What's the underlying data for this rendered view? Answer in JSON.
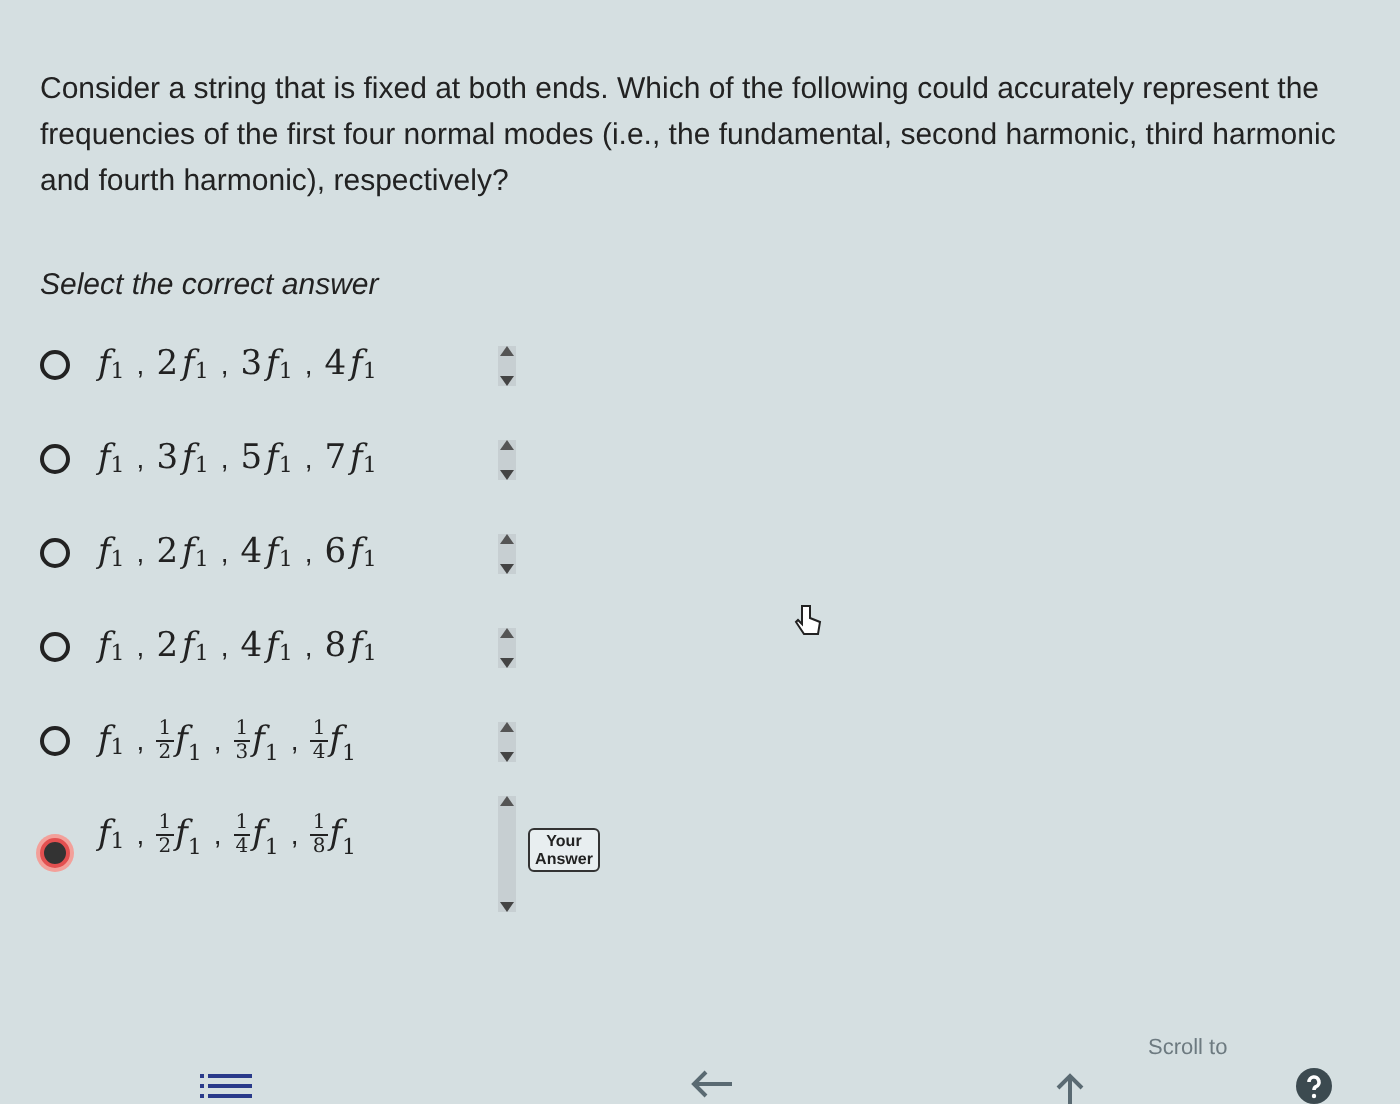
{
  "question": "Consider a string that is fixed at both ends. Which of the following could accurately represent the frequencies of the first four normal modes (i.e., the fundamental, second harmonic, third harmonic and fourth harmonic), respectively?",
  "instruction": "Select the correct answer",
  "options": [
    {
      "selected": false,
      "separator": ",",
      "terms": [
        {
          "var": "f",
          "sub": "1"
        },
        {
          "coef": "2",
          "var": "f",
          "sub": "1"
        },
        {
          "coef": "3",
          "var": "f",
          "sub": "1"
        },
        {
          "coef": "4",
          "var": "f",
          "sub": "1"
        }
      ]
    },
    {
      "selected": false,
      "separator": ",",
      "terms": [
        {
          "var": "f",
          "sub": "1"
        },
        {
          "coef": "3",
          "var": "f",
          "sub": "1"
        },
        {
          "coef": "5",
          "var": "f",
          "sub": "1"
        },
        {
          "coef": "7",
          "var": "f",
          "sub": "1"
        }
      ]
    },
    {
      "selected": false,
      "separator": ",",
      "terms": [
        {
          "var": "f",
          "sub": "1"
        },
        {
          "coef": "2",
          "var": "f",
          "sub": "1"
        },
        {
          "coef": "4",
          "var": "f",
          "sub": "1"
        },
        {
          "coef": "6",
          "var": "f",
          "sub": "1"
        }
      ]
    },
    {
      "selected": false,
      "separator": ",",
      "terms": [
        {
          "var": "f",
          "sub": "1"
        },
        {
          "coef": "2",
          "var": "f",
          "sub": "1"
        },
        {
          "coef": "4",
          "var": "f",
          "sub": "1"
        },
        {
          "coef": "8",
          "var": "f",
          "sub": "1"
        }
      ]
    },
    {
      "selected": false,
      "separator": ",",
      "terms": [
        {
          "var": "f",
          "sub": "1"
        },
        {
          "num": "1",
          "den": "2",
          "var": "f",
          "sub": "1"
        },
        {
          "num": "1",
          "den": "3",
          "var": "f",
          "sub": "1"
        },
        {
          "num": "1",
          "den": "4",
          "var": "f",
          "sub": "1"
        }
      ]
    },
    {
      "selected": true,
      "separator": ",",
      "badge": "Your Answer",
      "terms": [
        {
          "var": "f",
          "sub": "1"
        },
        {
          "num": "1",
          "den": "2",
          "var": "f",
          "sub": "1"
        },
        {
          "num": "1",
          "den": "4",
          "var": "f",
          "sub": "1"
        },
        {
          "num": "1",
          "den": "8",
          "var": "f",
          "sub": "1"
        }
      ]
    }
  ],
  "footer": {
    "scroll_label": "Scroll to"
  }
}
